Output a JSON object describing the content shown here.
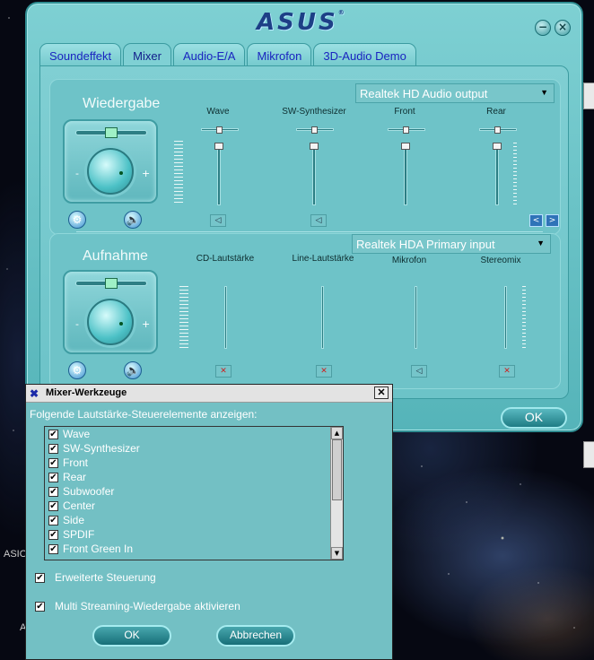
{
  "desktop": {
    "label_1": "ASIO",
    "label_2": "A"
  },
  "asus_window": {
    "logo": "ASUS",
    "logo_mark": "®",
    "minimize_glyph": "−",
    "close_glyph": "×",
    "tabs": [
      {
        "label": "Soundeffekt"
      },
      {
        "label": "Mixer"
      },
      {
        "label": "Audio-E/A"
      },
      {
        "label": "Mikrofon"
      },
      {
        "label": "3D-Audio Demo"
      }
    ],
    "active_tab": "Mixer",
    "playback": {
      "title": "Wiedergabe",
      "device": "Realtek HD Audio output",
      "minus": "-",
      "plus": "+",
      "channels": [
        {
          "label": "Wave",
          "muted": false
        },
        {
          "label": "SW-Synthesizer",
          "muted": false
        },
        {
          "label": "Front",
          "muted": false
        },
        {
          "label": "Rear",
          "muted": false
        }
      ],
      "nav_prev": "<",
      "nav_next": ">"
    },
    "recording": {
      "title": "Aufnahme",
      "device": "Realtek HDA Primary input",
      "minus": "-",
      "plus": "+",
      "channels": [
        {
          "label": "CD-Lautstärke",
          "muted": true
        },
        {
          "label": "Line-Lautstärke",
          "muted": true
        },
        {
          "label": "Mikrofon",
          "muted": false
        },
        {
          "label": "Stereomix",
          "muted": true
        }
      ]
    },
    "ok_label": "OK",
    "dropdown_arrow": "▼",
    "icons": {
      "settings": "settings-icon",
      "speaker": "speaker-icon"
    }
  },
  "mixer_tools": {
    "title": "Mixer-Werkzeuge",
    "close_glyph": "✕",
    "prompt": "Folgende Lautstärke-Steuerelemente anzeigen:",
    "items": [
      {
        "label": "Wave",
        "checked": true
      },
      {
        "label": "SW-Synthesizer",
        "checked": true
      },
      {
        "label": "Front",
        "checked": true
      },
      {
        "label": "Rear",
        "checked": true
      },
      {
        "label": "Subwoofer",
        "checked": true
      },
      {
        "label": "Center",
        "checked": true
      },
      {
        "label": "Side",
        "checked": true
      },
      {
        "label": "SPDIF",
        "checked": true
      },
      {
        "label": "Front Green In",
        "checked": true
      }
    ],
    "check_glyph": "✔",
    "advanced_label": "Erweiterte Steuerung",
    "advanced_checked": true,
    "multistream_label": "Multi Streaming-Wiedergabe aktivieren",
    "multistream_checked": true,
    "ok_label": "OK",
    "cancel_label": "Abbrechen"
  }
}
